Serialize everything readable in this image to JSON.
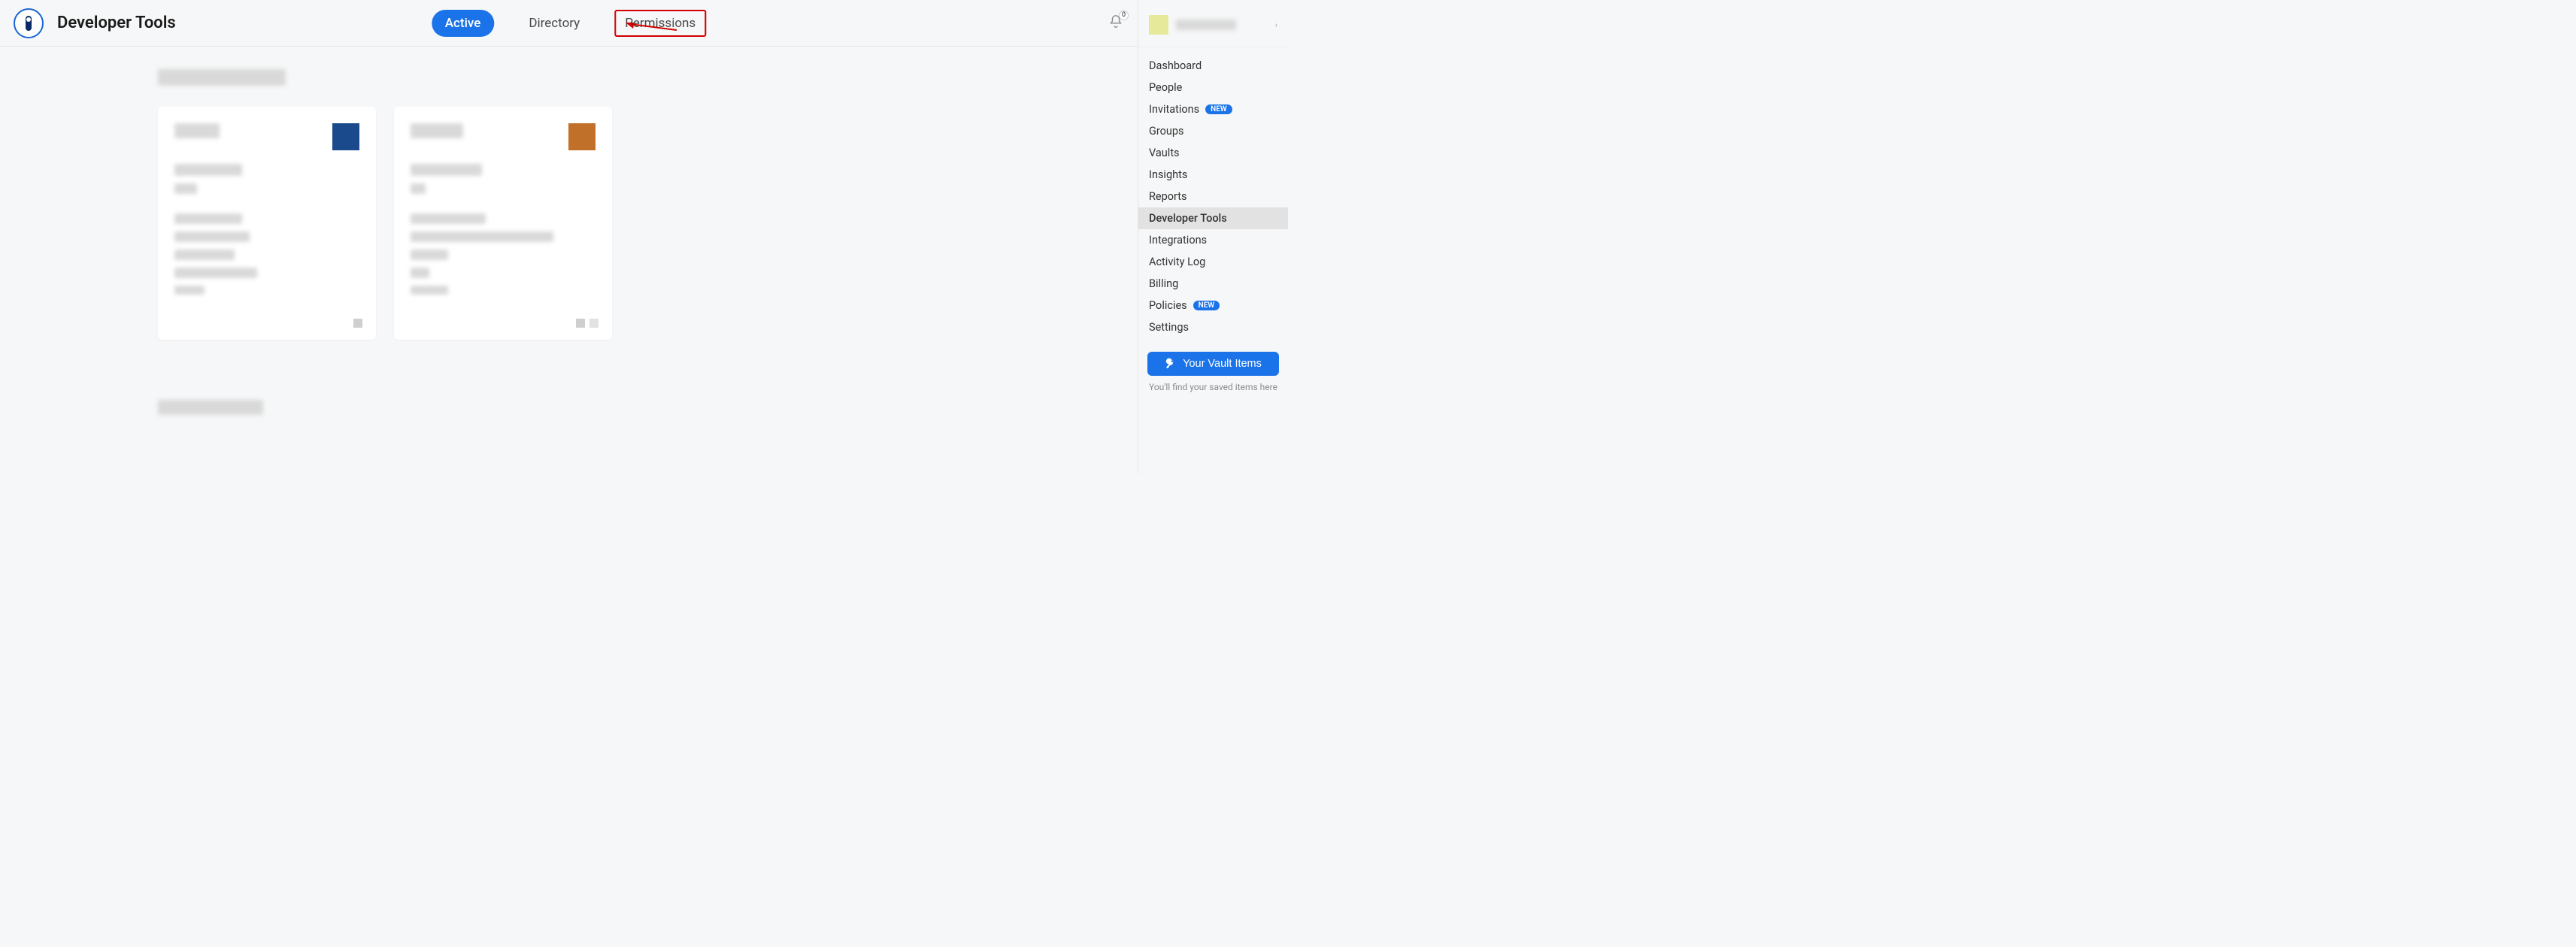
{
  "header": {
    "page_title": "Developer Tools",
    "tabs": {
      "active": "Active",
      "directory": "Directory",
      "permissions": "Permissions"
    },
    "notification_count": "0"
  },
  "cards": [
    {
      "swatch": "blue"
    },
    {
      "swatch": "orange"
    }
  ],
  "sidebar": {
    "nav": {
      "dashboard": "Dashboard",
      "people": "People",
      "invitations": "Invitations",
      "groups": "Groups",
      "vaults": "Vaults",
      "insights": "Insights",
      "reports": "Reports",
      "developer_tools": "Developer Tools",
      "integrations": "Integrations",
      "activity_log": "Activity Log",
      "billing": "Billing",
      "policies": "Policies",
      "settings": "Settings"
    },
    "badges": {
      "new": "NEW"
    },
    "vault_button": "Your Vault Items",
    "hint": "You'll find your saved items here"
  }
}
